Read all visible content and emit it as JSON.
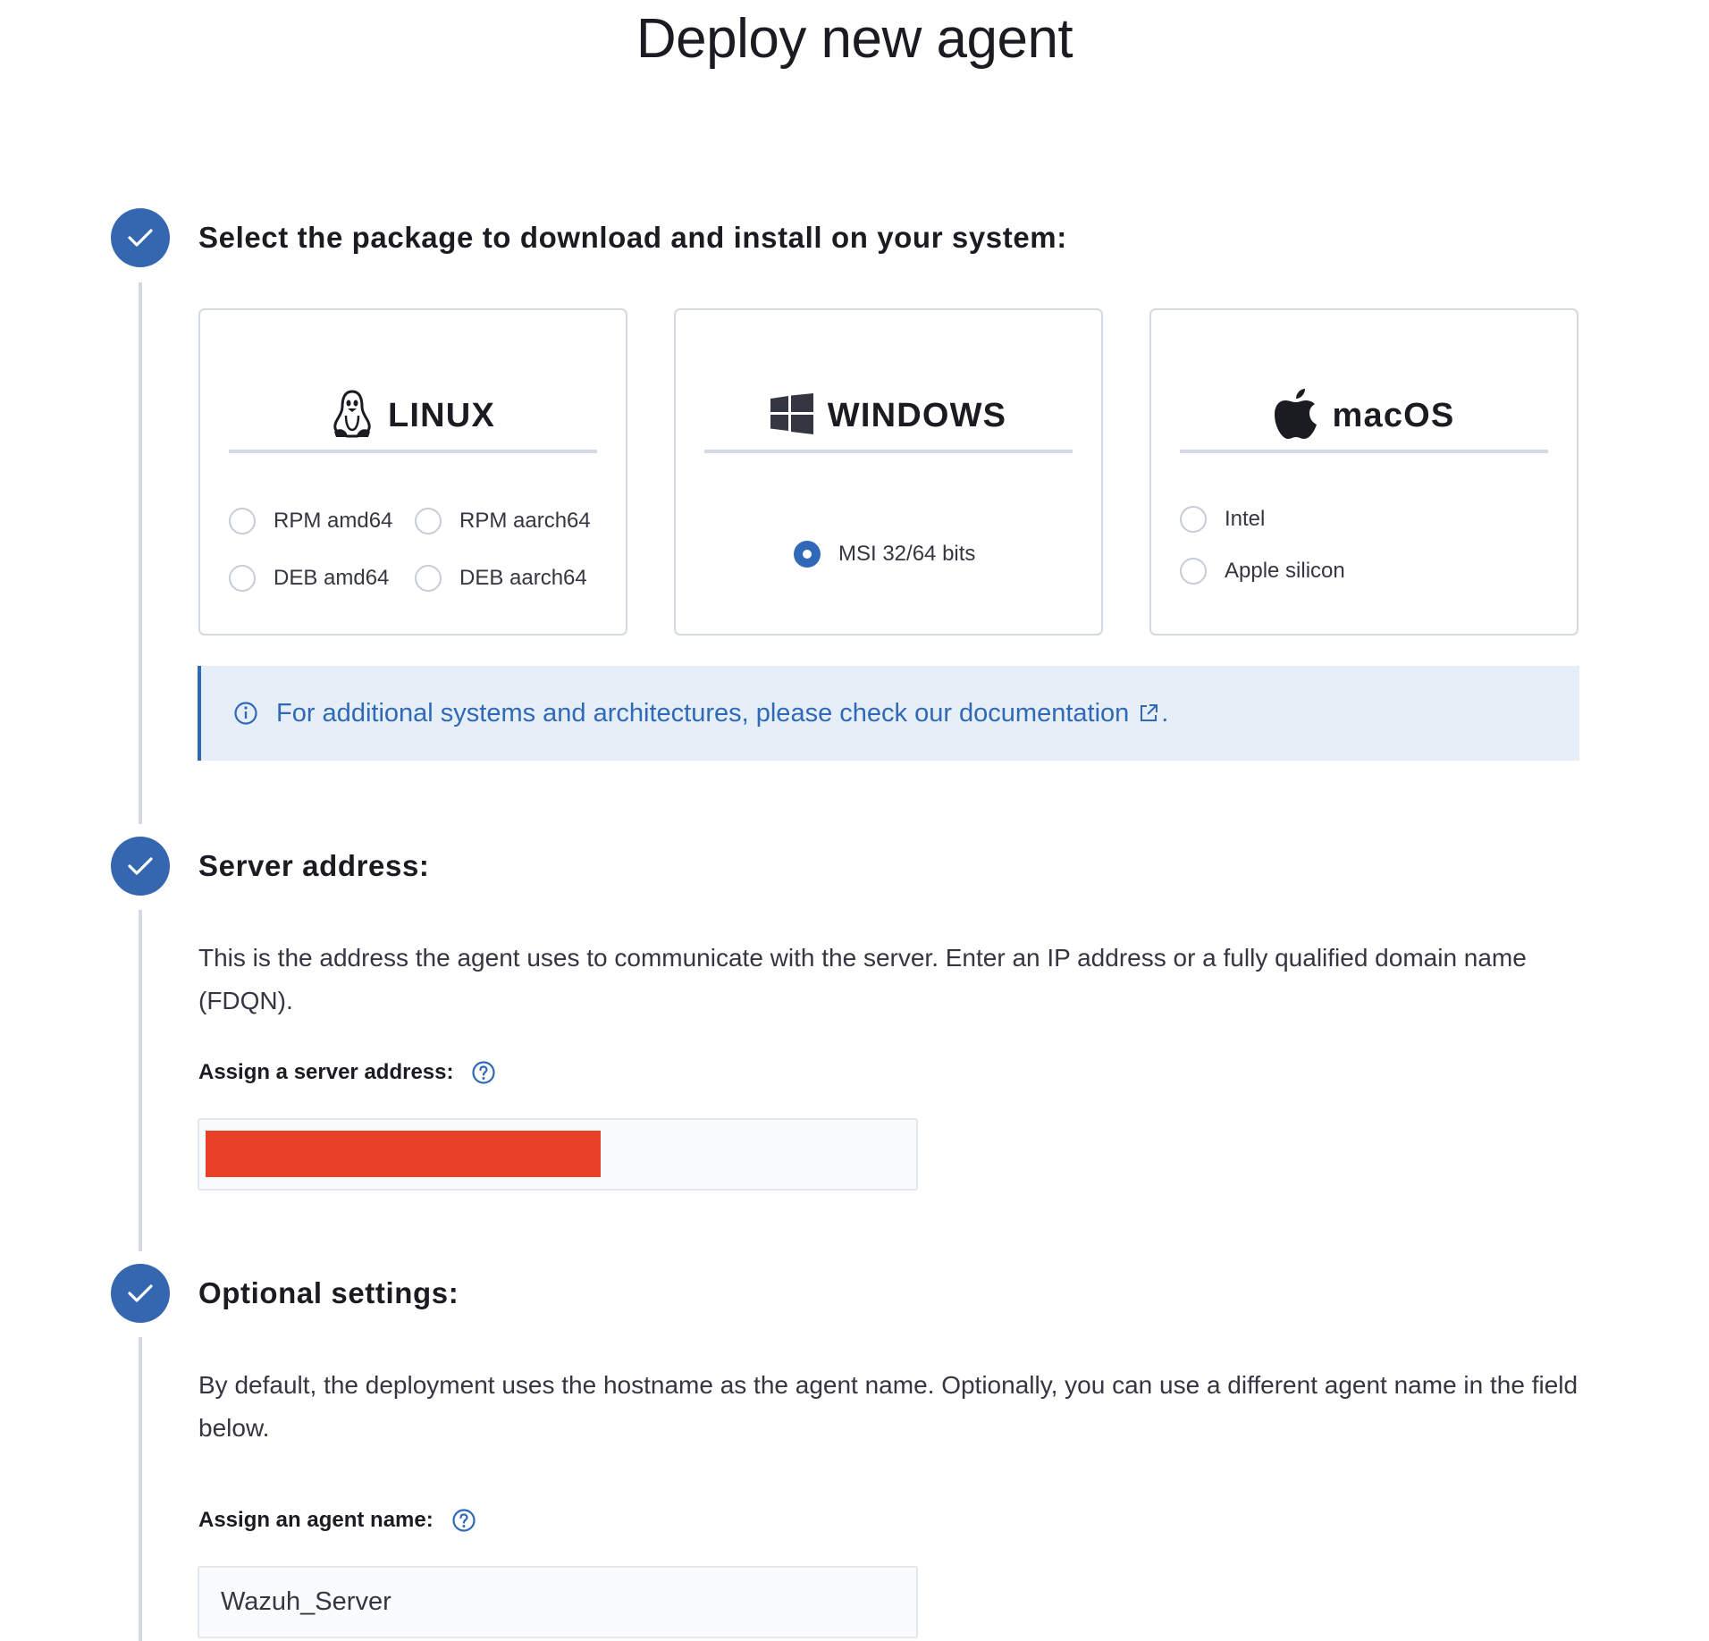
{
  "page": {
    "title": "Deploy new agent"
  },
  "steps": [
    {
      "title": "Select the package to download and install on your system:"
    },
    {
      "title": "Server address:",
      "description": "This is the address the agent uses to communicate with the server. Enter an IP address or a fully qualified domain name (FDQN).",
      "field_label": "Assign a server address:",
      "field_value": ""
    },
    {
      "title": "Optional settings:",
      "description": "By default, the deployment uses the hostname as the agent name. Optionally, you can use a different agent name in the field below.",
      "field_label": "Assign an agent name:",
      "field_value": "Wazuh_Server"
    }
  ],
  "os_cards": {
    "linux": {
      "name": "LINUX",
      "icon": "linux-tux-icon",
      "options": [
        "RPM amd64",
        "RPM aarch64",
        "DEB amd64",
        "DEB aarch64"
      ]
    },
    "windows": {
      "name": "WINDOWS",
      "icon": "windows-icon",
      "options": [
        "MSI 32/64 bits"
      ],
      "selected": "MSI 32/64 bits"
    },
    "macos": {
      "name": "macOS",
      "icon": "apple-icon",
      "options": [
        "Intel",
        "Apple silicon"
      ]
    }
  },
  "callout": {
    "text": "For additional systems and architectures, please check our documentation",
    "suffix": "."
  },
  "colors": {
    "accent": "#2f69b7",
    "step_circle": "#3467b0",
    "callout_bg": "#e6eef7",
    "redaction": "#e94128"
  }
}
